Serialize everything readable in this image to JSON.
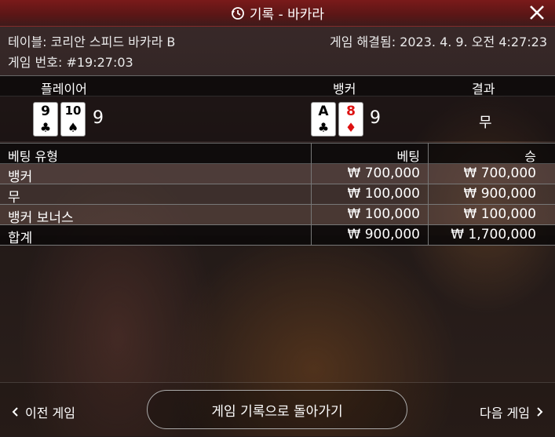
{
  "title": "기록 - 바카라",
  "info": {
    "table_label": "테이블: 코리안 스피드 바카라 B",
    "resolved_label": "게임 해결됨: 2023. 4. 9. 오전 4:27:23",
    "round_label": "게임 번호: #19:27:03"
  },
  "result_headers": {
    "player": "플레이어",
    "banker": "뱅커",
    "result": "결과"
  },
  "player_cards": [
    {
      "rank": "9",
      "suit": "♣"
    },
    {
      "rank": "10",
      "suit": "♠"
    }
  ],
  "player_score": "9",
  "banker_cards": [
    {
      "rank": "A",
      "suit": "♣"
    },
    {
      "rank": "8",
      "suit": "♦"
    }
  ],
  "banker_score": "9",
  "result_value": "무",
  "bet_headers": {
    "type": "베팅 유형",
    "bet": "베팅",
    "win": "승"
  },
  "bets": [
    {
      "type": "뱅커",
      "bet": "₩ 700,000",
      "win": "₩ 700,000"
    },
    {
      "type": "무",
      "bet": "₩ 100,000",
      "win": "₩ 900,000"
    },
    {
      "type": "뱅커 보너스",
      "bet": "₩ 100,000",
      "win": "₩ 100,000"
    }
  ],
  "total": {
    "type": "합계",
    "bet": "₩ 900,000",
    "win": "₩ 1,700,000"
  },
  "footer": {
    "prev": "이전 게임",
    "back": "게임 기록으로 돌아가기",
    "next": "다음 게임"
  },
  "colors": {
    "title_bar": "#6a1818",
    "red_suit": "#dd1111"
  }
}
